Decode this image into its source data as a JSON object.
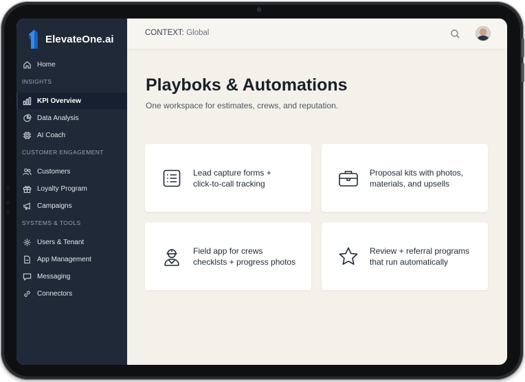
{
  "brand": {
    "name": "ElevateOne",
    "suffix": ".ai"
  },
  "sidebar": {
    "home": "Home",
    "sections": {
      "insights": "INSIGHTS",
      "customer_engagement": "CUSTOMER ENGAGEMENT",
      "systems_tools": "SYSTEMS & TOOLS"
    },
    "items": {
      "kpi_overview": "KPI Overview",
      "data_analysis": "Data Analysis",
      "ai_coach": "AI Coach",
      "customers": "Customers",
      "loyalty_program": "Loyalty Program",
      "campaigns": "Campaigns",
      "users_tenant": "Users & Tenant",
      "app_management": "App Management",
      "messaging": "Messaging",
      "connectors": "Connectors"
    },
    "active_item": "KPI Overview"
  },
  "topbar": {
    "context_label": "CONTEXT:",
    "context_value": "Global"
  },
  "page": {
    "title": "Playboks & Automations",
    "subtitle": "One workspace for estimates, crews, and reputation."
  },
  "cards": [
    {
      "icon": "list-icon",
      "line1": "Lead capture forms +",
      "line2": "click-to-call tracking"
    },
    {
      "icon": "briefcase-icon",
      "line1": "Proposal kits with photos,",
      "line2": "materials, and upsells"
    },
    {
      "icon": "worker-icon",
      "line1": "Field app for crews",
      "line2": "checklsts + progress photos"
    },
    {
      "icon": "star-icon",
      "line1": "Review + referral programs",
      "line2": "that run automatically"
    }
  ],
  "colors": {
    "sidebar_bg": "#1f2937",
    "content_bg": "#f4f1ea",
    "brand_blue": "#2f8df0"
  }
}
